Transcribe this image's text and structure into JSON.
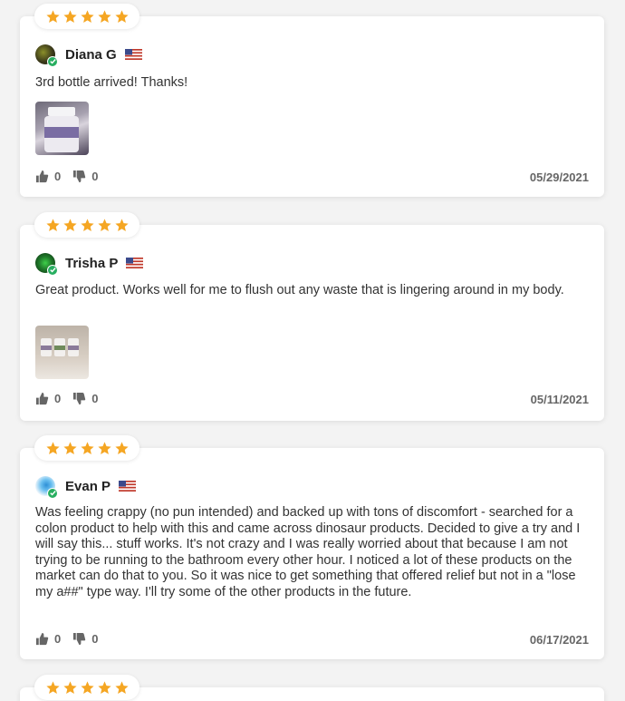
{
  "colors": {
    "star": "#f5a623",
    "verified": "#27ae60",
    "card": "#ffffff"
  },
  "reviews": [
    {
      "rating": 5,
      "author": "Diana G",
      "country_flag": "us-flag-icon",
      "text": "3rd bottle arrived! Thanks!",
      "has_photo": true,
      "likes": "0",
      "dislikes": "0",
      "date": "05/29/2021"
    },
    {
      "rating": 5,
      "author": "Trisha P",
      "country_flag": "us-flag-icon",
      "text": "Great product. Works well for me to flush out any waste that is lingering around in my body.",
      "has_photo": true,
      "likes": "0",
      "dislikes": "0",
      "date": "05/11/2021"
    },
    {
      "rating": 5,
      "author": "Evan P",
      "country_flag": "us-flag-icon",
      "text": "Was feeling crappy (no pun intended) and backed up with tons of discomfort - searched for a colon product to help with this and came across dinosaur products. Decided to give a try and I will say this... stuff works. It's not crazy and I was really worried about that because I am not trying to be running to the bathroom every other hour. I noticed a lot of these products on the market can do that to you. So it was nice to get something that offered relief but not in a \"lose my a##\" type way. I'll try some of the other products in the future.",
      "has_photo": false,
      "likes": "0",
      "dislikes": "0",
      "date": "06/17/2021"
    },
    {
      "rating": 5
    }
  ]
}
